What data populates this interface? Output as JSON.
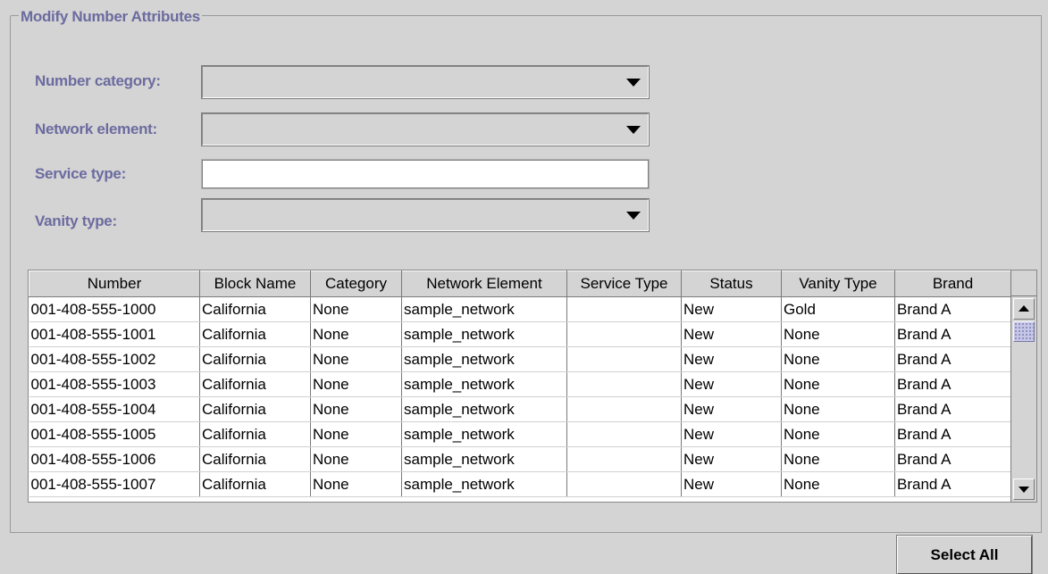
{
  "group": {
    "title": "Modify Number Attributes"
  },
  "form": {
    "number_category_label": "Number category:",
    "network_element_label": "Network element:",
    "service_type_label": "Service type:",
    "vanity_type_label": "Vanity type:",
    "number_category_value": "",
    "network_element_value": "",
    "service_type_value": "",
    "vanity_type_value": ""
  },
  "table": {
    "columns": [
      "Number",
      "Block Name",
      "Category",
      "Network Element",
      "Service Type",
      "Status",
      "Vanity Type",
      "Brand"
    ],
    "rows": [
      [
        "001-408-555-1000",
        "California",
        "None",
        "sample_network",
        "",
        "New",
        "Gold",
        "Brand A"
      ],
      [
        "001-408-555-1001",
        "California",
        "None",
        "sample_network",
        "",
        "New",
        "None",
        "Brand A"
      ],
      [
        "001-408-555-1002",
        "California",
        "None",
        "sample_network",
        "",
        "New",
        "None",
        "Brand A"
      ],
      [
        "001-408-555-1003",
        "California",
        "None",
        "sample_network",
        "",
        "New",
        "None",
        "Brand A"
      ],
      [
        "001-408-555-1004",
        "California",
        "None",
        "sample_network",
        "",
        "New",
        "None",
        "Brand A"
      ],
      [
        "001-408-555-1005",
        "California",
        "None",
        "sample_network",
        "",
        "New",
        "None",
        "Brand A"
      ],
      [
        "001-408-555-1006",
        "California",
        "None",
        "sample_network",
        "",
        "New",
        "None",
        "Brand A"
      ],
      [
        "001-408-555-1007",
        "California",
        "None",
        "sample_network",
        "",
        "New",
        "None",
        "Brand A"
      ]
    ]
  },
  "buttons": {
    "select_all": "Select All"
  },
  "colors": {
    "label": "#6b6ba0",
    "background": "#d4d4d4",
    "scroll_thumb": "#c6c6e6"
  },
  "icons": {
    "combo_arrow": "chevron-down-icon",
    "scroll_up": "arrow-up-icon",
    "scroll_down": "arrow-down-icon"
  }
}
